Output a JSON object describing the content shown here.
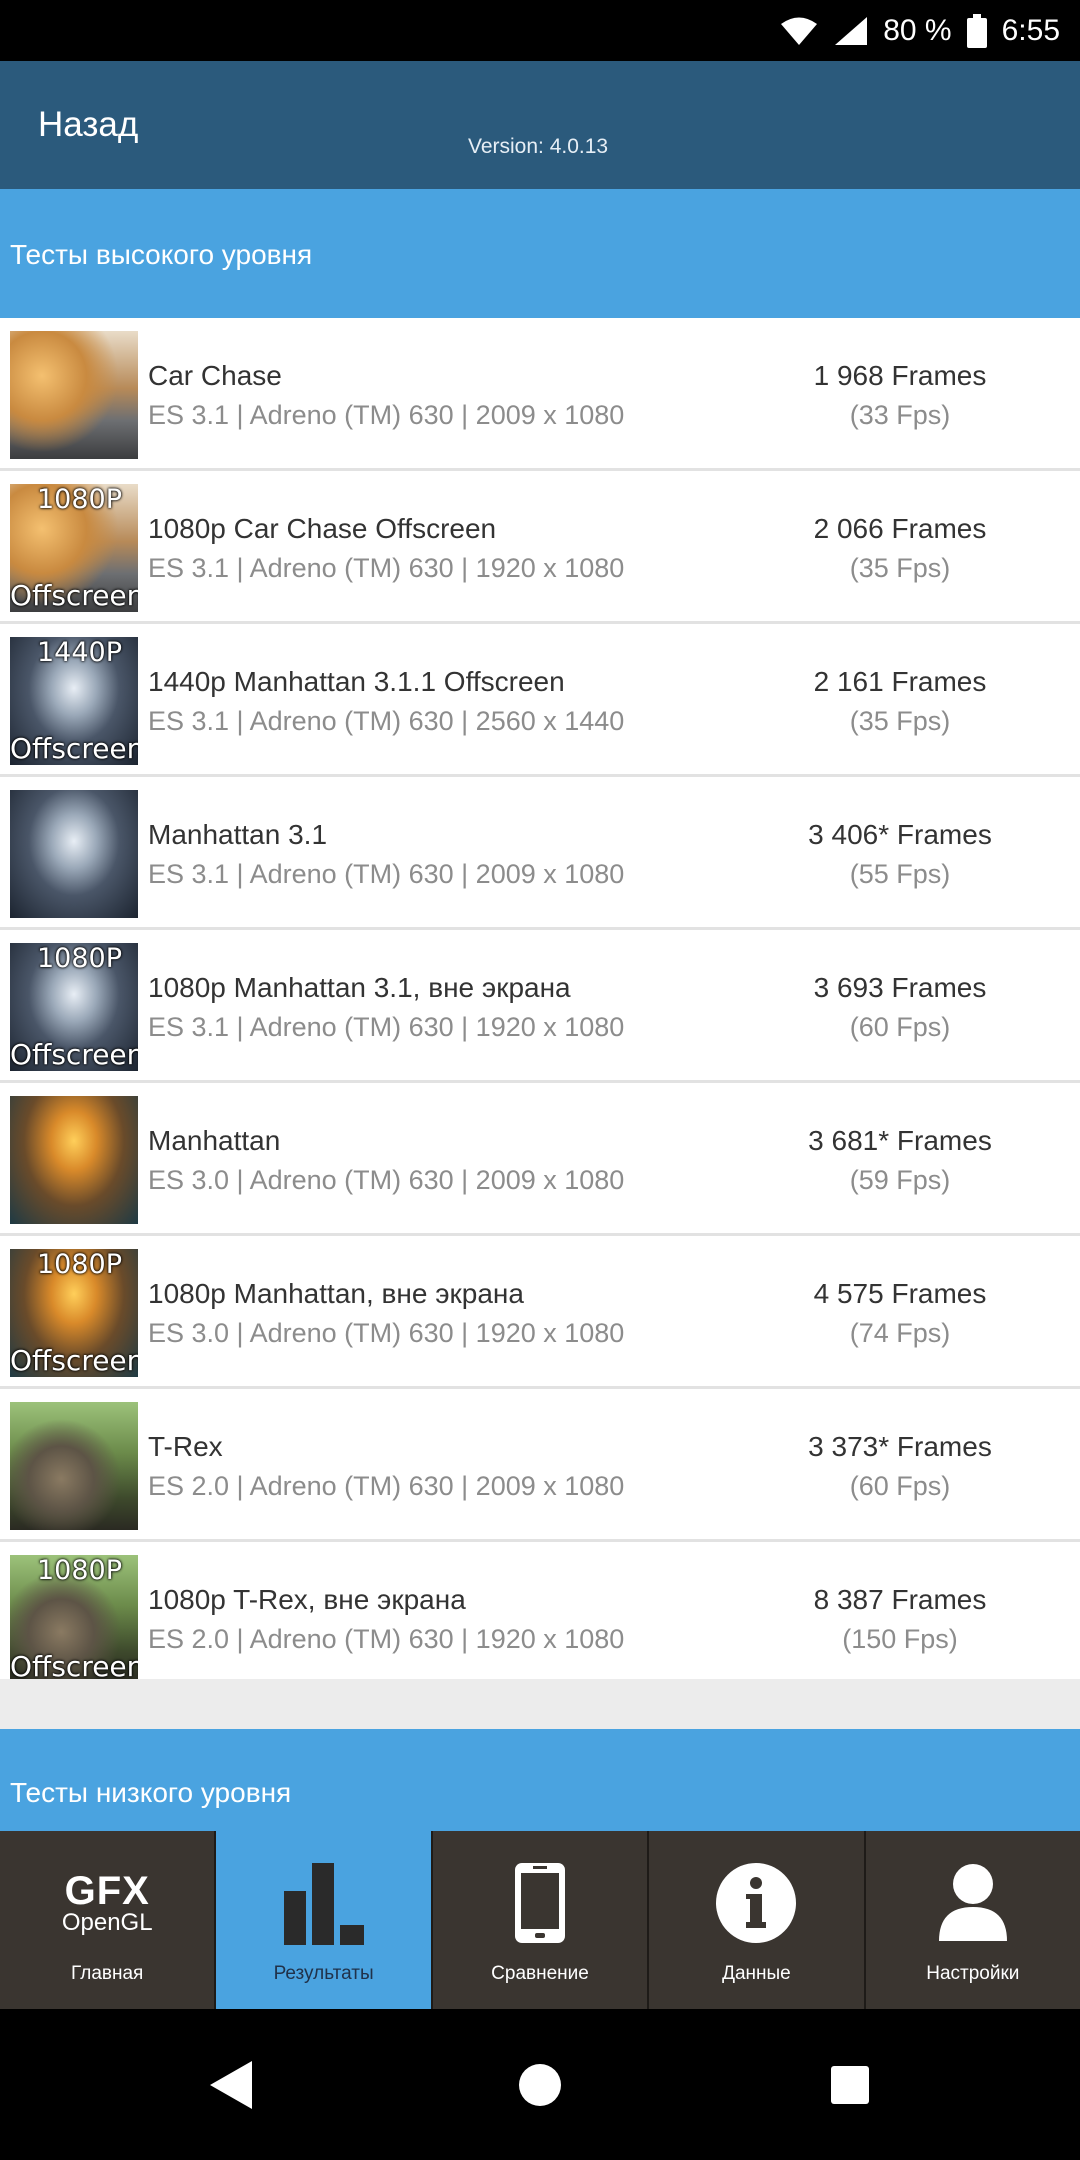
{
  "status_bar": {
    "battery": "80 %",
    "time": "6:55"
  },
  "header": {
    "back_label": "Назад",
    "version": "Version: 4.0.13"
  },
  "high_level": {
    "title": "Тесты высокого уровня",
    "tests": [
      {
        "name": "Car Chase",
        "details": "ES 3.1 | Adreno (TM) 630 | 2009 x 1080",
        "score": "1 968 Frames",
        "fps": "(33 Fps)",
        "thumb_top": "",
        "thumb_bottom": "",
        "thumb_scene": "car"
      },
      {
        "name": "1080p Car Chase Offscreen",
        "details": "ES 3.1 | Adreno (TM) 630 | 1920 x 1080",
        "score": "2 066 Frames",
        "fps": "(35 Fps)",
        "thumb_top": "1080P",
        "thumb_bottom": "Offscreen",
        "thumb_scene": "car"
      },
      {
        "name": "1440p Manhattan 3.1.1 Offscreen",
        "details": "ES 3.1 | Adreno (TM) 630 | 2560 x 1440",
        "score": "2 161 Frames",
        "fps": "(35 Fps)",
        "thumb_top": "1440P",
        "thumb_bottom": "Offscreen",
        "thumb_scene": "robot"
      },
      {
        "name": "Manhattan 3.1",
        "details": "ES 3.1 | Adreno (TM) 630 | 2009 x 1080",
        "score": "3 406* Frames",
        "fps": "(55 Fps)",
        "thumb_top": "",
        "thumb_bottom": "",
        "thumb_scene": "robot"
      },
      {
        "name": "1080p Manhattan 3.1, вне экрана",
        "details": "ES 3.1 | Adreno (TM) 630 | 1920 x 1080",
        "score": "3 693 Frames",
        "fps": "(60 Fps)",
        "thumb_top": "1080P",
        "thumb_bottom": "Offscreen",
        "thumb_scene": "robot"
      },
      {
        "name": "Manhattan",
        "details": "ES 3.0 | Adreno (TM) 630 | 2009 x 1080",
        "score": "3 681* Frames",
        "fps": "(59 Fps)",
        "thumb_top": "",
        "thumb_bottom": "",
        "thumb_scene": "mech"
      },
      {
        "name": "1080p Manhattan, вне экрана",
        "details": "ES 3.0 | Adreno (TM) 630 | 1920 x 1080",
        "score": "4 575 Frames",
        "fps": "(74 Fps)",
        "thumb_top": "1080P",
        "thumb_bottom": "Offscreen",
        "thumb_scene": "mech"
      },
      {
        "name": "T-Rex",
        "details": "ES 2.0 | Adreno (TM) 630 | 2009 x 1080",
        "score": "3 373* Frames",
        "fps": "(60 Fps)",
        "thumb_top": "",
        "thumb_bottom": "",
        "thumb_scene": "trex"
      },
      {
        "name": "1080p T-Rex, вне экрана",
        "details": "ES 2.0 | Adreno (TM) 630 | 1920 x 1080",
        "score": "8 387 Frames",
        "fps": "(150 Fps)",
        "thumb_top": "1080P",
        "thumb_bottom": "Offscreen",
        "thumb_scene": "trex"
      }
    ]
  },
  "low_level": {
    "title": "Тесты низкого уровня"
  },
  "bottom_nav": {
    "items": [
      {
        "label": "Главная",
        "icon": "gfx-opengl-logo",
        "logo_line1": "GFX",
        "logo_line2": "OpenGL",
        "active": false
      },
      {
        "label": "Результаты",
        "icon": "bar-chart-icon",
        "active": true
      },
      {
        "label": "Сравнение",
        "icon": "phone-icon",
        "active": false
      },
      {
        "label": "Данные",
        "icon": "info-icon",
        "active": false
      },
      {
        "label": "Настройки",
        "icon": "user-icon",
        "active": false
      }
    ]
  },
  "colors": {
    "status_bar": "#000000",
    "app_bar": "#2b5a7c",
    "section_header": "#4aa3e0",
    "bottom_nav": "#3a3530",
    "active_tab": "#4aa3e0"
  }
}
